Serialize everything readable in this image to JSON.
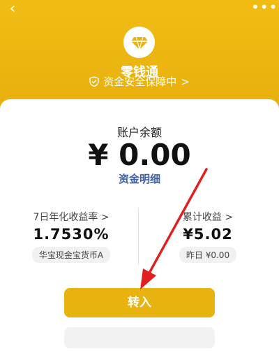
{
  "header": {
    "app_title": "零钱通",
    "security_text": "资金安全保障中",
    "security_chevron": ">",
    "back_icon": "chevron-left-icon",
    "more_icon": "more-dots-icon",
    "logo_icon": "diamond-icon"
  },
  "balance": {
    "label": "账户余额",
    "amount": "¥ 0.00",
    "detail_link": "资金明细"
  },
  "stats": {
    "left": {
      "label": "7日年化收益率 >",
      "value": "1.7530%",
      "chip": "华宝现金宝货币A"
    },
    "right": {
      "label": "累计收益 >",
      "value": "¥5.02",
      "chip": "昨日 ¥0.00"
    }
  },
  "actions": {
    "transfer_in": "转入"
  },
  "colors": {
    "brand_yellow": "#e8b20f",
    "link_blue": "#3b5faa",
    "annotation_red": "#e02020"
  }
}
